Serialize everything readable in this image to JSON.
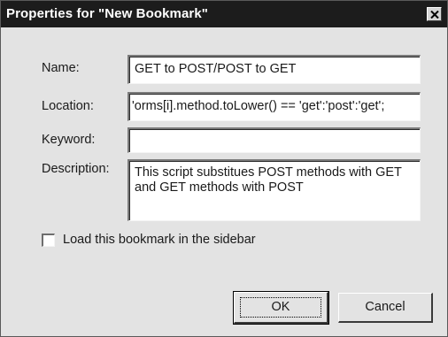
{
  "window": {
    "title": "Properties for \"New Bookmark\""
  },
  "form": {
    "name_label": "Name:",
    "name_value": "GET to POST/POST to GET",
    "location_label": "Location:",
    "location_value": "'orms[i].method.toLower() == 'get':'post':'get';",
    "keyword_label": "Keyword:",
    "keyword_value": "",
    "description_label": "Description:",
    "description_value": "This script substitues POST methods with GET and GET methods with POST"
  },
  "options": {
    "sidebar_checkbox_label": "Load this bookmark in the sidebar",
    "sidebar_checked": false
  },
  "buttons": {
    "ok_label": "OK",
    "cancel_label": "Cancel"
  },
  "icons": {
    "close": "close-icon"
  },
  "colors": {
    "titlebar": "#1c1c1c",
    "dialog_background": "#e3e3e3",
    "field_background": "#ffffff"
  }
}
